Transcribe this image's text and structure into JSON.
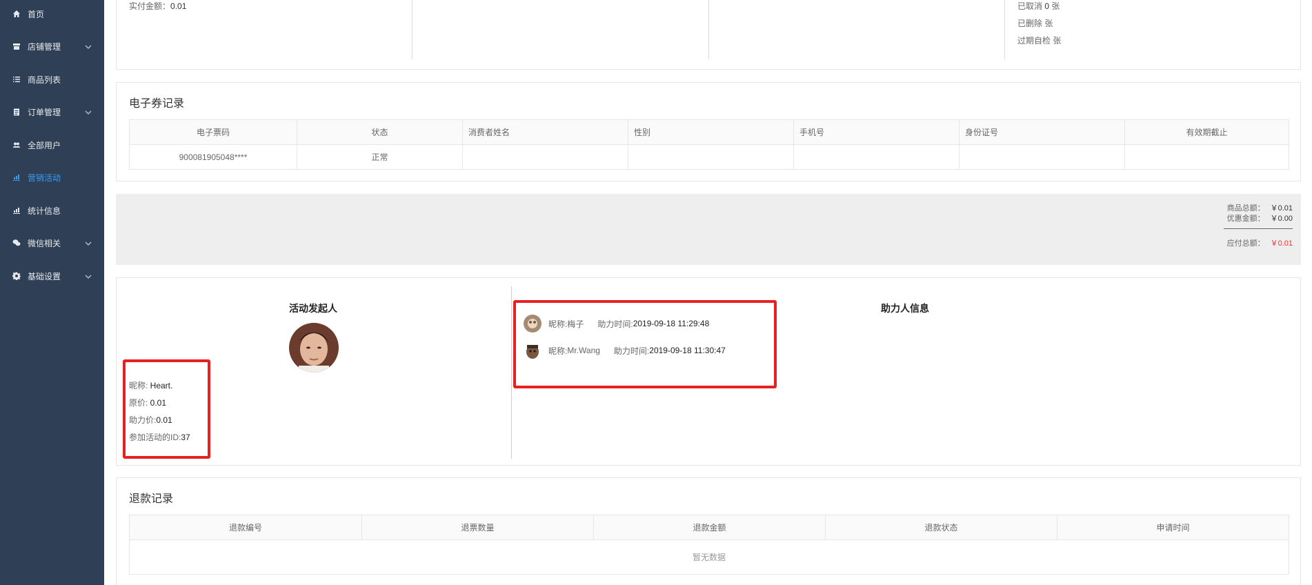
{
  "sidebar": {
    "items": [
      {
        "label": "首页",
        "icon": "home-icon",
        "arrow": false,
        "active": false
      },
      {
        "label": "店铺管理",
        "icon": "shop-icon",
        "arrow": true,
        "active": false
      },
      {
        "label": "商品列表",
        "icon": "list-icon",
        "arrow": false,
        "active": false
      },
      {
        "label": "订单管理",
        "icon": "clipboard-icon",
        "arrow": true,
        "active": false
      },
      {
        "label": "全部用户",
        "icon": "users-icon",
        "arrow": false,
        "active": false
      },
      {
        "label": "营销活动",
        "icon": "chart-icon",
        "arrow": false,
        "active": true
      },
      {
        "label": "统计信息",
        "icon": "stats-icon",
        "arrow": false,
        "active": false
      },
      {
        "label": "微信相关",
        "icon": "wechat-icon",
        "arrow": true,
        "active": false
      },
      {
        "label": "基础设置",
        "icon": "gear-icon",
        "arrow": true,
        "active": false
      }
    ]
  },
  "top": {
    "paid_label": "实付金额：",
    "paid_value": "0.01",
    "cancelled_label": "已取消",
    "cancelled_value": "0",
    "cancelled_unit": "张",
    "deleted": "已删除 张",
    "expired": "过期自检 张"
  },
  "voucher": {
    "title": "电子券记录",
    "headers": [
      "电子票码",
      "状态",
      "消费者姓名",
      "性别",
      "手机号",
      "身份证号",
      "有效期截止"
    ],
    "rows": [
      [
        "900081905048****",
        "正常",
        "",
        "",
        "",
        "",
        ""
      ]
    ]
  },
  "summary": {
    "goods_total_label": "商品总额：",
    "goods_total_value": "￥0.01",
    "discount_label": "优惠金额：",
    "discount_value": "￥0.00",
    "payable_label": "应付总额：",
    "payable_value": "￥0.01"
  },
  "activity": {
    "initiator_title": "活动发起人",
    "helper_title": "助力人信息",
    "nickname_label": "昵称: ",
    "nickname_value": "Heart.",
    "original_price_label": "原价: ",
    "original_price_value": "0.01",
    "help_price_label": "助力价:",
    "help_price_value": "0.01",
    "activity_id_label": "参加活动的ID:",
    "activity_id_value": "37",
    "helpers": [
      {
        "nick_label": "昵称: ",
        "nick": "梅子",
        "time_label": "助力时间: ",
        "time": "2019-09-18 11:29:48"
      },
      {
        "nick_label": "昵称: ",
        "nick": "Mr.Wang",
        "time_label": "助力时间: ",
        "time": "2019-09-18 11:30:47"
      }
    ]
  },
  "refund": {
    "title": "退款记录",
    "headers": [
      "退款编号",
      "退票数量",
      "退款金额",
      "退款状态",
      "申请时间"
    ],
    "empty": "暂无数据"
  },
  "colors": {
    "sidebar_bg": "#2f4056",
    "active": "#3a9cf0",
    "highlight_red": "#e8201f",
    "price_red": "#ff2b2b"
  }
}
